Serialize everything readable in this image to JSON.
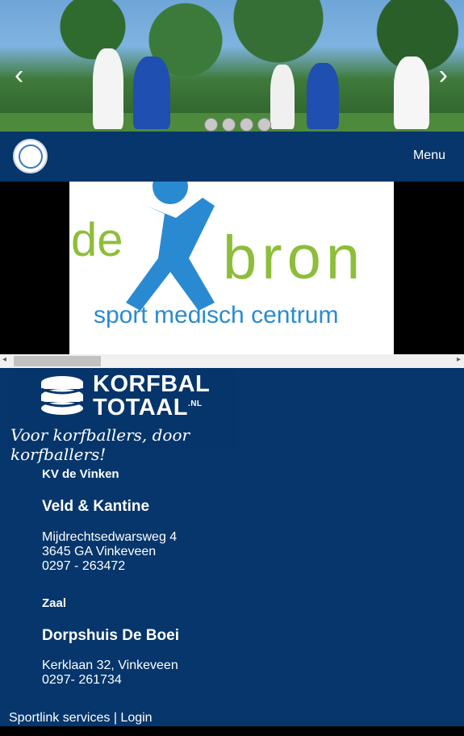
{
  "carousel": {
    "prev_icon": "chevron-left-icon",
    "next_icon": "chevron-right-icon",
    "prev_glyph": "‹",
    "next_glyph": "›",
    "indicator_count": 4
  },
  "navbar": {
    "logo_icon": "club-logo",
    "menu_label": "Menu"
  },
  "sponsor": {
    "word_de": "de",
    "word_bron": "bron",
    "tagline": "sport medisch centrum",
    "color_green": "#8dbd3a",
    "color_blue": "#2a8ad1"
  },
  "footer": {
    "kt_logo": {
      "line1": "KORFBAL",
      "line2": "TOTAAL",
      "suffix": ".NL",
      "tagline": "Voor korfballers, door korfballers!"
    },
    "club_name": "KV de Vinken",
    "venue1": {
      "title": "Veld & Kantine",
      "street": "Mijdrechtsedwarsweg 4",
      "city": "3645 GA Vinkeveen",
      "phone": "0297 - 263472"
    },
    "zaal_label": "Zaal",
    "venue2": {
      "title": "Dorpshuis De Boei",
      "street": "Kerklaan 32, Vinkeveen",
      "phone": "0297- 261734"
    },
    "links": {
      "sportlink": "Sportlink services",
      "separator": " | ",
      "login": "Login"
    }
  },
  "colors": {
    "navy": "#06366b"
  }
}
